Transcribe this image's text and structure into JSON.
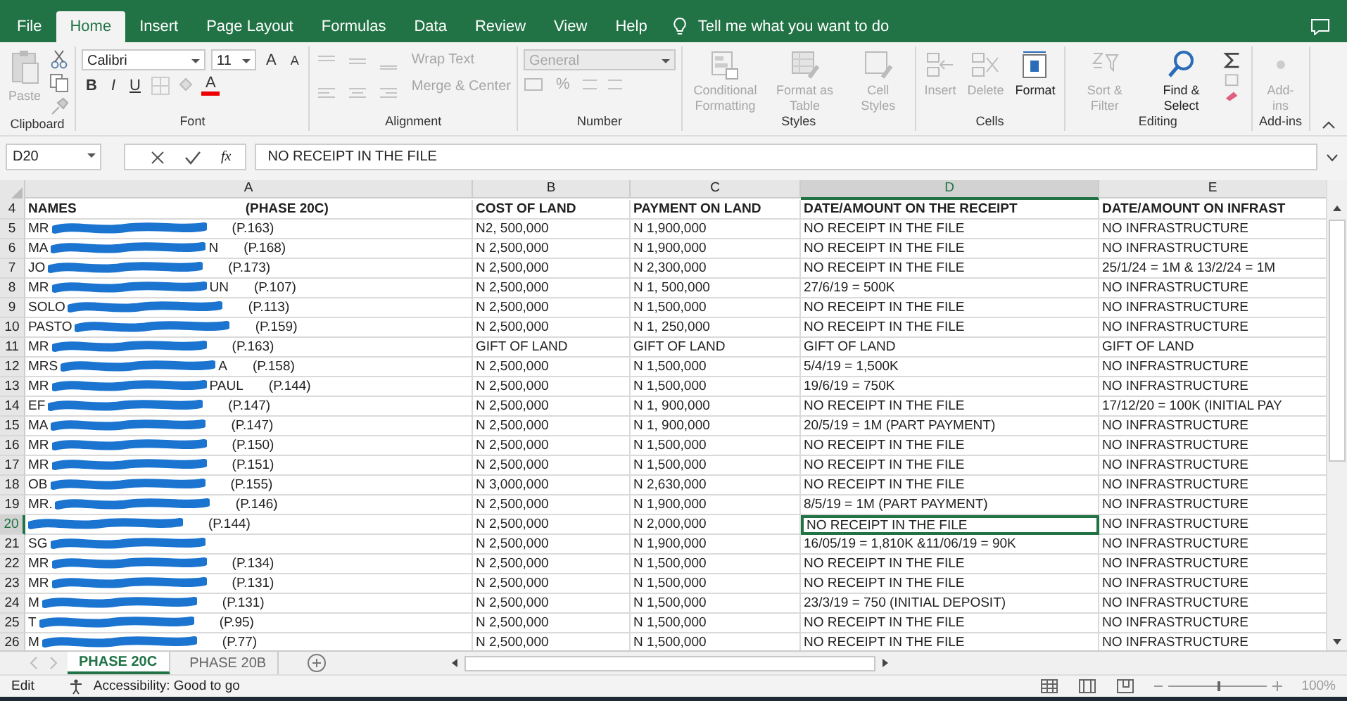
{
  "ribbon_tabs": [
    {
      "label": "File",
      "selected": false
    },
    {
      "label": "Home",
      "selected": true
    },
    {
      "label": "Insert",
      "selected": false
    },
    {
      "label": "Page Layout",
      "selected": false
    },
    {
      "label": "Formulas",
      "selected": false
    },
    {
      "label": "Data",
      "selected": false
    },
    {
      "label": "Review",
      "selected": false
    },
    {
      "label": "View",
      "selected": false
    },
    {
      "label": "Help",
      "selected": false
    }
  ],
  "tell_me": {
    "placeholder": "Tell me what you want to do"
  },
  "ribbon": {
    "clipboard": {
      "label": "Clipboard",
      "paste": {
        "label": "Paste",
        "disabled": true
      }
    },
    "font": {
      "label": "Font",
      "font_name": "Calibri",
      "font_size": "11",
      "grow": "A",
      "shrink": "A",
      "bold": "B",
      "italic": "I",
      "underline": "U",
      "font_color": "A"
    },
    "alignment": {
      "label": "Alignment",
      "wrap_text": {
        "label": "Wrap Text",
        "disabled": true
      },
      "merge": {
        "label": "Merge & Center",
        "disabled": true
      }
    },
    "number": {
      "label": "Number",
      "format": "General",
      "percent": "%"
    },
    "styles": {
      "label": "Styles",
      "buttons": [
        {
          "label": "Conditional Formatting",
          "kind": "conditional",
          "disabled": true
        },
        {
          "label": "Format as Table",
          "kind": "table",
          "disabled": true
        },
        {
          "label": "Cell Styles",
          "kind": "styles",
          "disabled": true
        }
      ]
    },
    "cells": {
      "label": "Cells",
      "buttons": [
        {
          "label": "Insert",
          "kind": "insert",
          "disabled": true
        },
        {
          "label": "Delete",
          "kind": "delete",
          "disabled": true
        },
        {
          "label": "Format",
          "kind": "format",
          "disabled": false
        }
      ]
    },
    "editing": {
      "label": "Editing",
      "buttons": [
        {
          "label": "Sort & Filter",
          "kind": "sort",
          "disabled": true
        },
        {
          "label": "Find & Select",
          "kind": "find",
          "disabled": false
        }
      ]
    },
    "addins": {
      "label": "Add-ins",
      "buttons": [
        {
          "label": "Add-ins",
          "kind": "addins",
          "disabled": true
        }
      ]
    }
  },
  "formula_bar": {
    "name_box": "D20",
    "fx": "fx",
    "value": "NO RECEIPT IN THE FILE"
  },
  "columns": [
    {
      "label": "A",
      "selected": false
    },
    {
      "label": "B",
      "selected": false
    },
    {
      "label": "C",
      "selected": false
    },
    {
      "label": "D",
      "selected": true
    },
    {
      "label": "E",
      "selected": false
    }
  ],
  "header_row": {
    "number": "4",
    "names": "NAMES",
    "phase": "(PHASE 20C)",
    "cells": [
      "COST OF LAND",
      "PAYMENT ON LAND",
      "DATE/AMOUNT ON THE RECEIPT",
      "DATE/AMOUNT ON INFRAST"
    ]
  },
  "rows": [
    {
      "number": "5",
      "prefix": "MR",
      "suffix": "",
      "ref": "(P.163)",
      "cells": [
        "N2, 500,000",
        "N 1,900,000",
        "NO RECEIPT IN THE FILE",
        "NO INFRASTRUCTURE"
      ],
      "selected": false
    },
    {
      "number": "6",
      "prefix": "MA",
      "suffix": "N",
      "ref": "(P.168)",
      "cells": [
        "N 2,500,000",
        "N 1,900,000",
        "NO RECEIPT IN THE FILE",
        "NO INFRASTRUCTURE"
      ],
      "selected": false
    },
    {
      "number": "7",
      "prefix": "JO",
      "suffix": "",
      "ref": "(P.173)",
      "cells": [
        "N 2,500,000",
        "N 2,300,000",
        "NO RECEIPT IN THE FILE",
        "25/1/24 = 1M & 13/2/24 = 1M"
      ],
      "selected": false
    },
    {
      "number": "8",
      "prefix": "MR",
      "suffix": "UN",
      "ref": "(P.107)",
      "cells": [
        "N 2,500,000",
        "N 1, 500,000",
        "27/6/19 = 500K",
        "NO INFRASTRUCTURE"
      ],
      "selected": false
    },
    {
      "number": "9",
      "prefix": "SOLO",
      "suffix": "",
      "ref": "(P.113)",
      "cells": [
        "N 2,500,000",
        "N 1,500,000",
        "NO RECEIPT IN THE FILE",
        "NO INFRASTRUCTURE"
      ],
      "selected": false
    },
    {
      "number": "10",
      "prefix": "PASTO",
      "suffix": "",
      "ref": "(P.159)",
      "cells": [
        "N 2,500,000",
        "N 1, 250,000",
        "NO RECEIPT IN THE FILE",
        "NO INFRASTRUCTURE"
      ],
      "selected": false
    },
    {
      "number": "11",
      "prefix": "MR",
      "suffix": "",
      "ref": "(P.163)",
      "cells": [
        "GIFT OF LAND",
        "GIFT OF LAND",
        "GIFT OF LAND",
        "GIFT OF LAND"
      ],
      "selected": false
    },
    {
      "number": "12",
      "prefix": "MRS",
      "suffix": "A",
      "ref": "(P.158)",
      "cells": [
        "N 2,500,000",
        "N 1,500,000",
        "5/4/19 = 1,500K",
        "NO INFRASTRUCTURE"
      ],
      "selected": false
    },
    {
      "number": "13",
      "prefix": "MR",
      "suffix": "PAUL",
      "ref": "(P.144)",
      "cells": [
        "N 2,500,000",
        "N 1,500,000",
        "19/6/19 = 750K",
        "NO INFRASTRUCTURE"
      ],
      "selected": false
    },
    {
      "number": "14",
      "prefix": "EF",
      "suffix": "",
      "ref": "(P.147)",
      "cells": [
        "N 2,500,000",
        "N 1, 900,000",
        "NO RECEIPT IN THE FILE",
        "17/12/20 = 100K (INITIAL PAY"
      ],
      "selected": false
    },
    {
      "number": "15",
      "prefix": "MA",
      "suffix": "",
      "ref": "(P.147)",
      "cells": [
        "N 2,500,000",
        "N 1, 900,000",
        "20/5/19 = 1M (PART PAYMENT)",
        "NO INFRASTRUCTURE"
      ],
      "selected": false
    },
    {
      "number": "16",
      "prefix": "MR",
      "suffix": "",
      "ref": "(P.150)",
      "cells": [
        "N 2,500,000",
        "N 1,500,000",
        "NO RECEIPT IN THE FILE",
        "NO INFRASTRUCTURE"
      ],
      "selected": false
    },
    {
      "number": "17",
      "prefix": "MR",
      "suffix": "",
      "ref": "(P.151)",
      "cells": [
        "N 2,500,000",
        "N 1,500,000",
        "NO RECEIPT IN THE FILE",
        "NO INFRASTRUCTURE"
      ],
      "selected": false
    },
    {
      "number": "18",
      "prefix": "OB",
      "suffix": "",
      "ref": "(P.155)",
      "cells": [
        "N 3,000,000",
        "N 2,630,000",
        "NO RECEIPT IN THE FILE",
        "NO INFRASTRUCTURE"
      ],
      "selected": false
    },
    {
      "number": "19",
      "prefix": "MR.",
      "suffix": "",
      "ref": "(P.146)",
      "cells": [
        "N 2,500,000",
        "N 1,900,000",
        "8/5/19 = 1M (PART PAYMENT)",
        "NO INFRASTRUCTURE"
      ],
      "selected": false
    },
    {
      "number": "20",
      "prefix": "",
      "suffix": "",
      "ref": "(P.144)",
      "cells": [
        "N 2,500,000",
        "N 2,000,000",
        "NO RECEIPT IN THE FILE",
        "NO INFRASTRUCTURE"
      ],
      "selected": true
    },
    {
      "number": "21",
      "prefix": "SG",
      "suffix": "",
      "ref": "",
      "cells": [
        "N 2,500,000",
        "N 1,900,000",
        "16/05/19 = 1,810K &11/06/19 = 90K",
        "NO INFRASTRUCTURE"
      ],
      "selected": false
    },
    {
      "number": "22",
      "prefix": "MR",
      "suffix": "",
      "ref": "(P.134)",
      "cells": [
        "N 2,500,000",
        "N 1,500,000",
        "NO RECEIPT IN THE FILE",
        "NO INFRASTRUCTURE"
      ],
      "selected": false
    },
    {
      "number": "23",
      "prefix": "MR",
      "suffix": "",
      "ref": "(P.131)",
      "cells": [
        "N 2,500,000",
        "N 1,500,000",
        "NO RECEIPT IN THE FILE",
        "NO INFRASTRUCTURE"
      ],
      "selected": false
    },
    {
      "number": "24",
      "prefix": "M",
      "suffix": "",
      "ref": "(P.131)",
      "cells": [
        "N 2,500,000",
        "N 1,500,000",
        "23/3/19 = 750 (INITIAL DEPOSIT)",
        "NO INFRASTRUCTURE"
      ],
      "selected": false
    },
    {
      "number": "25",
      "prefix": "T",
      "suffix": "",
      "ref": "(P.95)",
      "cells": [
        "N 2,500,000",
        "N 1,500,000",
        "NO RECEIPT IN THE FILE",
        "NO INFRASTRUCTURE"
      ],
      "selected": false
    },
    {
      "number": "26",
      "prefix": "M",
      "suffix": "",
      "ref": "(P.77)",
      "cells": [
        "N 2,500,000",
        "N 1,500,000",
        "NO RECEIPT IN THE FILE",
        "NO INFRASTRUCTURE"
      ],
      "selected": false
    }
  ],
  "sheet_tabs": [
    {
      "label": "PHASE 20C",
      "selected": true
    },
    {
      "label": "PHASE 20B",
      "selected": false
    }
  ],
  "status_bar": {
    "mode": "Edit",
    "accessibility": "Accessibility: Good to go",
    "zoom": "100%",
    "zoom_slider": {
      "level": 0.5
    }
  }
}
